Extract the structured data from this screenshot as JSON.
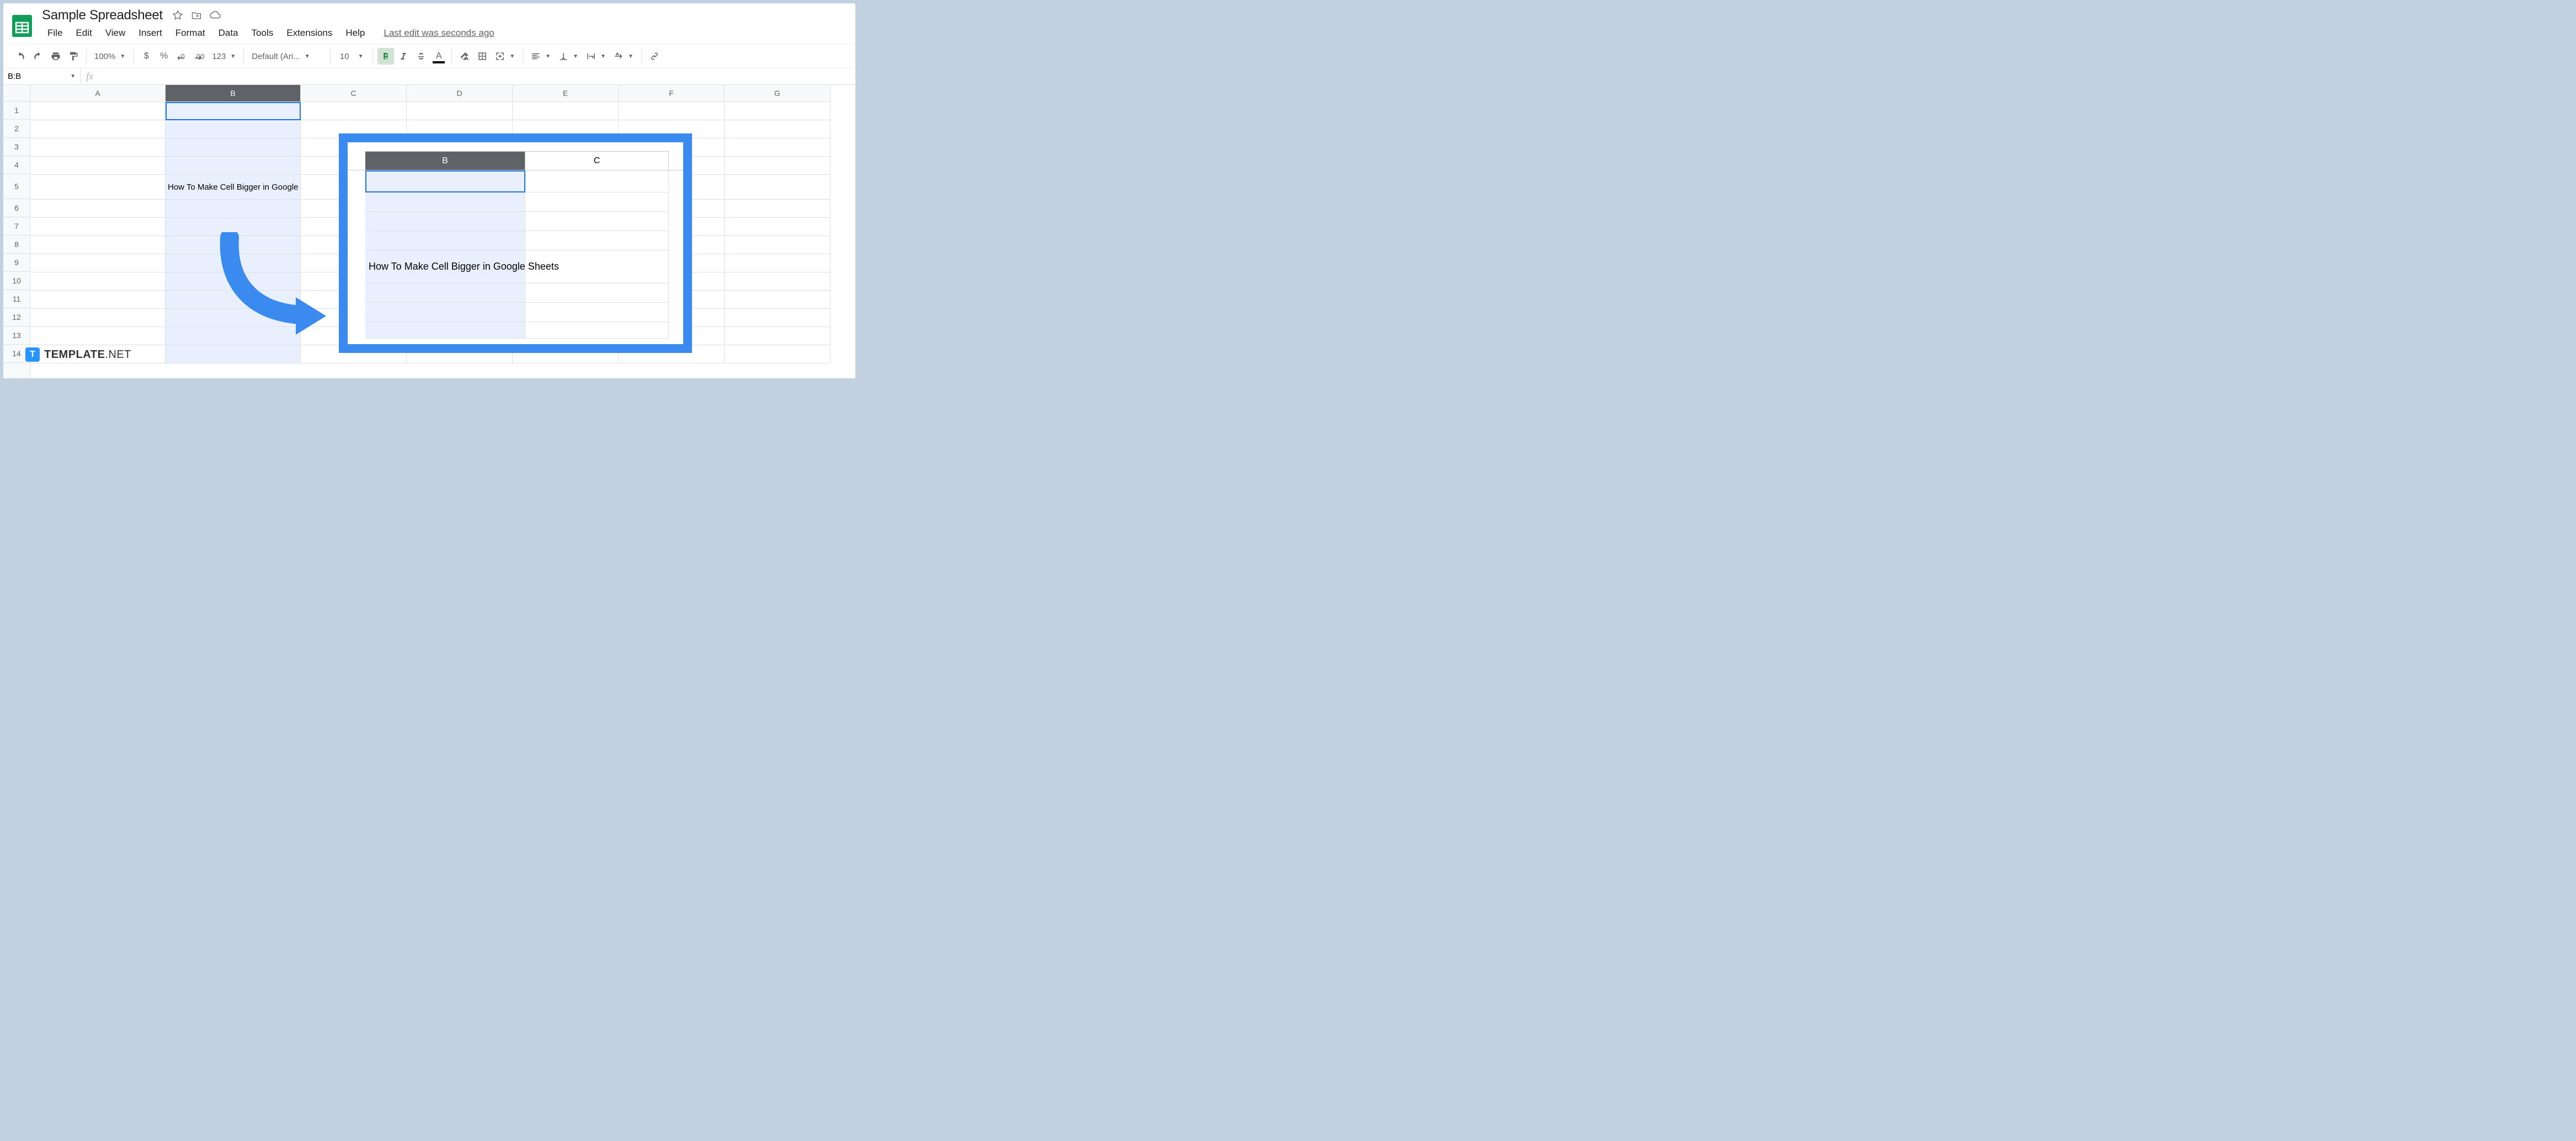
{
  "header": {
    "title": "Sample Spreadsheet",
    "last_edit": "Last edit was seconds ago"
  },
  "menu": [
    "File",
    "Edit",
    "View",
    "Insert",
    "Format",
    "Data",
    "Tools",
    "Extensions",
    "Help"
  ],
  "toolbar": {
    "zoom": "100%",
    "currency": "$",
    "percent": "%",
    "dec_dec": ".0",
    "inc_dec": ".00",
    "more_fmt": "123",
    "font": "Default (Ari...",
    "fontsize": "10",
    "bold": "B",
    "italic": "I",
    "strike": "S",
    "textcolor": "A"
  },
  "namebox": "B:B",
  "fx_label": "fx",
  "columns": [
    "A",
    "B",
    "C",
    "D",
    "E",
    "F",
    "G"
  ],
  "rows": [
    "1",
    "2",
    "3",
    "4",
    "5",
    "6",
    "7",
    "8",
    "9",
    "10",
    "11",
    "12",
    "13",
    "14"
  ],
  "b5_text": "How To Make Cell Bigger in Google Sheets",
  "inset": {
    "columns": [
      "B",
      "C"
    ],
    "cell_text": "How To Make Cell Bigger in Google Sheets"
  },
  "watermark": {
    "logo": "T",
    "name": "TEMPLATE",
    "suffix": ".NET"
  }
}
